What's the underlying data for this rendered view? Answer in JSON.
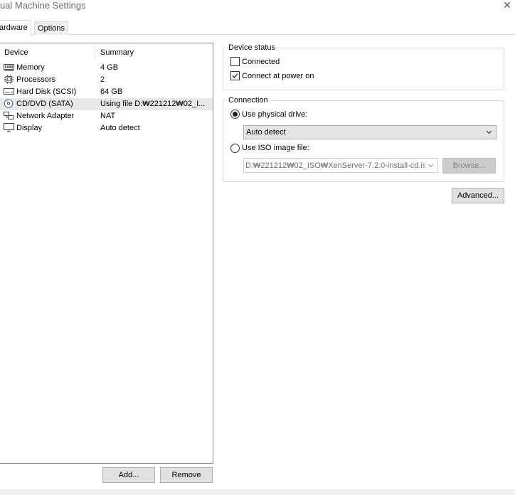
{
  "window": {
    "title": "rtual Machine Settings"
  },
  "tabs": {
    "hardware": "ardware",
    "options": "Options"
  },
  "device_list": {
    "headers": {
      "device": "Device",
      "summary": "Summary"
    },
    "rows": [
      {
        "device": "Memory",
        "summary": "4 GB",
        "icon": "memory-icon"
      },
      {
        "device": "Processors",
        "summary": "2",
        "icon": "processor-icon"
      },
      {
        "device": "Hard Disk (SCSI)",
        "summary": "64 GB",
        "icon": "hard-disk-icon"
      },
      {
        "device": "CD/DVD (SATA)",
        "summary": "Using file D:₩221212₩02_I...",
        "icon": "cd-dvd-icon",
        "selected": true
      },
      {
        "device": "Network Adapter",
        "summary": "NAT",
        "icon": "network-adapter-icon"
      },
      {
        "device": "Display",
        "summary": "Auto detect",
        "icon": "display-icon"
      }
    ]
  },
  "list_buttons": {
    "add": "Add...",
    "remove": "Remove"
  },
  "device_status": {
    "legend": "Device status",
    "connected": {
      "label": "Connected",
      "checked": false
    },
    "connect_at_power_on": {
      "label": "Connect at power on",
      "checked": true
    }
  },
  "connection": {
    "legend": "Connection",
    "physical_drive": {
      "label": "Use physical drive:",
      "selected": true,
      "value": "Auto detect"
    },
    "iso_image": {
      "label": "Use ISO image file:",
      "selected": false,
      "value": "D:₩221212₩02_ISO₩XenServer-7.2.0-install-cd.is",
      "browse": "Browse..."
    }
  },
  "advanced_button": "Advanced..."
}
